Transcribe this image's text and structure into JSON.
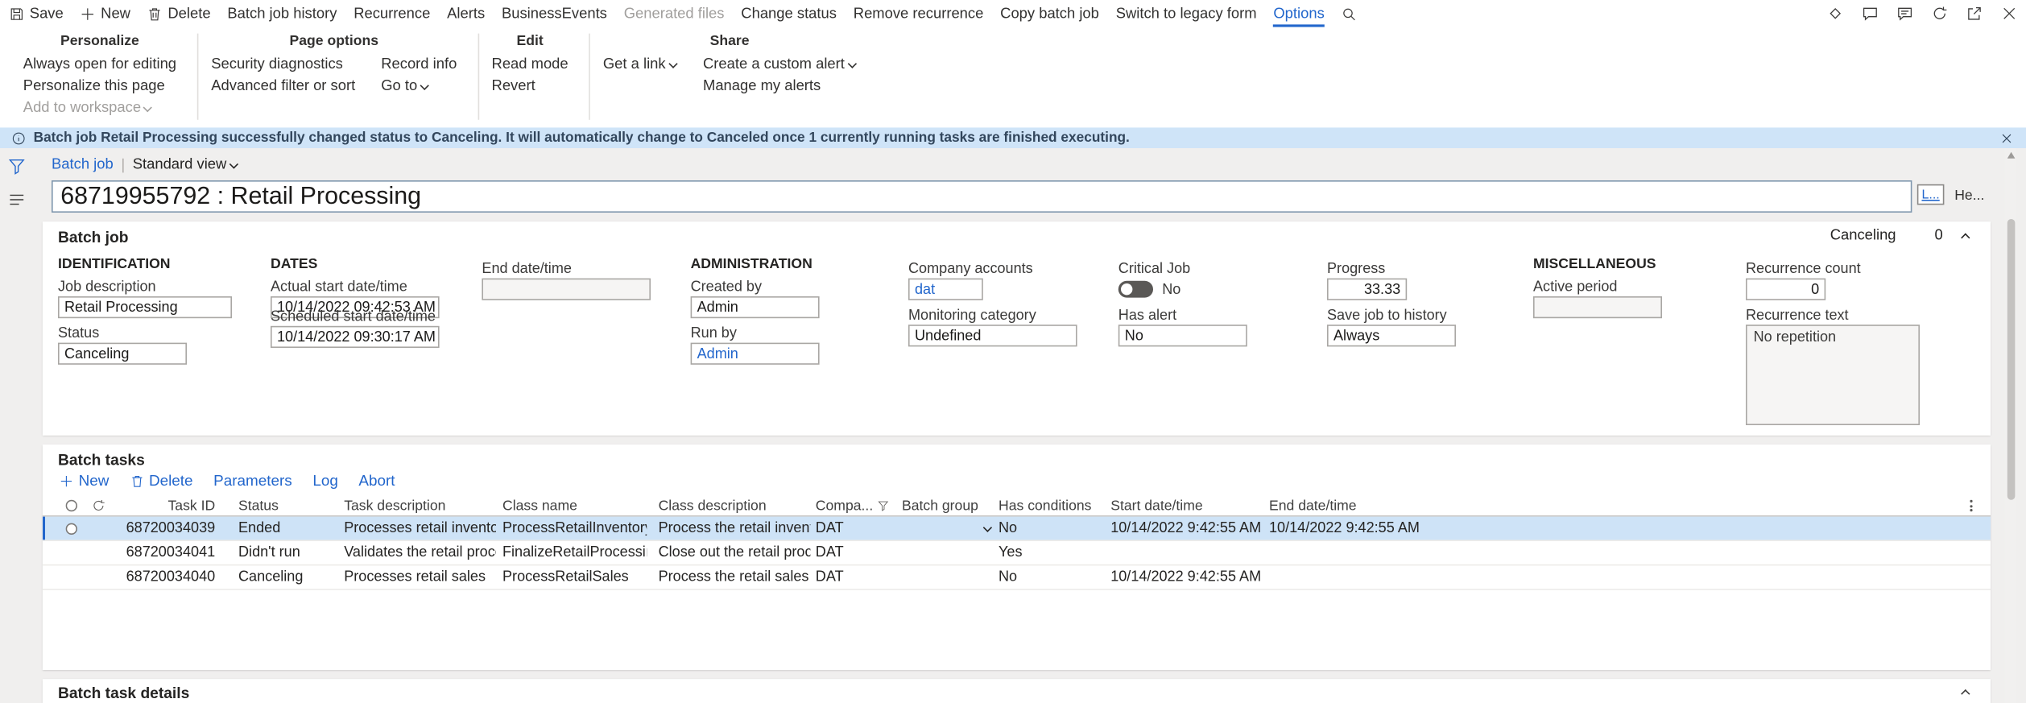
{
  "colors": {
    "accent": "#2266cc",
    "notification_bg": "#cfe4f8",
    "selected_row_bg": "#cee3f7"
  },
  "icons": {
    "save": "floppy",
    "new": "plus",
    "delete": "trash",
    "search": "magnifier",
    "copilot": "diamond",
    "chat": "bubble",
    "feedback": "bubble-lines",
    "refresh": "circular-arrow",
    "popout": "arrow-out",
    "close": "x",
    "info": "info-circle",
    "filter": "funnel",
    "list": "hamburger",
    "chevron": "caret",
    "kebab": "three-dots",
    "radio": "circle"
  },
  "command_bar": {
    "save": "Save",
    "new": "New",
    "delete": "Delete",
    "batch_job_history": "Batch job history",
    "recurrence": "Recurrence",
    "alerts": "Alerts",
    "business_events": "BusinessEvents",
    "generated_files": "Generated files",
    "change_status": "Change status",
    "remove_recurrence": "Remove recurrence",
    "copy_batch_job": "Copy batch job",
    "switch_to_legacy": "Switch to legacy form",
    "options": "Options"
  },
  "ribbon": {
    "personalize": {
      "title": "Personalize",
      "items": [
        "Always open for editing",
        "Personalize this page",
        "Add to workspace"
      ]
    },
    "page_options": {
      "title": "Page options",
      "col1": [
        "Security diagnostics",
        "Advanced filter or sort"
      ],
      "col2": [
        "Record info",
        "Go to"
      ]
    },
    "edit": {
      "title": "Edit",
      "items": [
        "Read mode",
        "Revert"
      ]
    },
    "share": {
      "title": "Share",
      "col1": [
        "Get a link"
      ],
      "col2": [
        "Create a custom alert",
        "Manage my alerts"
      ]
    }
  },
  "notification": {
    "message": "Batch job Retail Processing successfully changed status to Canceling. It will automatically change to Canceled once 1 currently running tasks are finished executing."
  },
  "nav": {
    "breadcrumb": "Batch job",
    "view": "Standard view"
  },
  "page": {
    "title": "68719955792 : Retail Processing",
    "lines_button": "L...",
    "header_button": "He..."
  },
  "batch_job": {
    "section_title": "Batch job",
    "status": "Canceling",
    "count": "0",
    "id_title": "IDENTIFICATION",
    "job_description_label": "Job description",
    "job_description": "Retail Processing",
    "status_label": "Status",
    "status_value": "Canceling",
    "dates_title": "DATES",
    "actual_start_label": "Actual start date/time",
    "actual_start": "10/14/2022 09:42:53 AM",
    "scheduled_start_label": "Scheduled start date/time",
    "scheduled_start": "10/14/2022 09:30:17 AM",
    "end_label": "End date/time",
    "end_value": "",
    "admin_title": "ADMINISTRATION",
    "created_by_label": "Created by",
    "created_by": "Admin",
    "run_by_label": "Run by",
    "run_by": "Admin",
    "company_label": "Company accounts",
    "company": "dat",
    "monitoring_label": "Monitoring category",
    "monitoring": "Undefined",
    "critical_label": "Critical Job",
    "critical_value": "No",
    "has_alert_label": "Has alert",
    "has_alert": "No",
    "progress_label": "Progress",
    "progress": "33.33",
    "save_history_label": "Save job to history",
    "save_history": "Always",
    "misc_title": "MISCELLANEOUS",
    "active_period_label": "Active period",
    "active_period": "",
    "recurrence_count_label": "Recurrence count",
    "recurrence_count": "0",
    "recurrence_text_label": "Recurrence text",
    "recurrence_text": "No repetition"
  },
  "batch_tasks": {
    "section_title": "Batch tasks",
    "toolbar": {
      "new": "New",
      "delete": "Delete",
      "parameters": "Parameters",
      "log": "Log",
      "abort": "Abort"
    },
    "columns": {
      "task_id": "Task ID",
      "status": "Status",
      "task_description": "Task description",
      "class_name": "Class name",
      "class_description": "Class description",
      "company": "Compa...",
      "batch_group": "Batch group",
      "has_conditions": "Has conditions",
      "start": "Start date/time",
      "end": "End date/time"
    },
    "rows": [
      {
        "task_id": "68720034039",
        "status": "Ended",
        "task_description": "Processes retail inventory",
        "class_name": "ProcessRetailInventory",
        "class_description": "Process the retail inventory",
        "company": "DAT",
        "batch_group": "",
        "has_conditions": "No",
        "start": "10/14/2022 9:42:55 AM",
        "end": "10/14/2022 9:42:55 AM"
      },
      {
        "task_id": "68720034041",
        "status": "Didn't run",
        "task_description": "Validates the retail process",
        "class_name": "FinalizeRetailProcessing",
        "class_description": "Close out the retail proce...",
        "company": "DAT",
        "batch_group": "",
        "has_conditions": "Yes",
        "start": "",
        "end": ""
      },
      {
        "task_id": "68720034040",
        "status": "Canceling",
        "task_description": "Processes retail sales",
        "class_name": "ProcessRetailSales",
        "class_description": "Process the retail sales",
        "company": "DAT",
        "batch_group": "",
        "has_conditions": "No",
        "start": "10/14/2022 9:42:55 AM",
        "end": ""
      }
    ]
  },
  "details": {
    "title": "Batch task details"
  }
}
